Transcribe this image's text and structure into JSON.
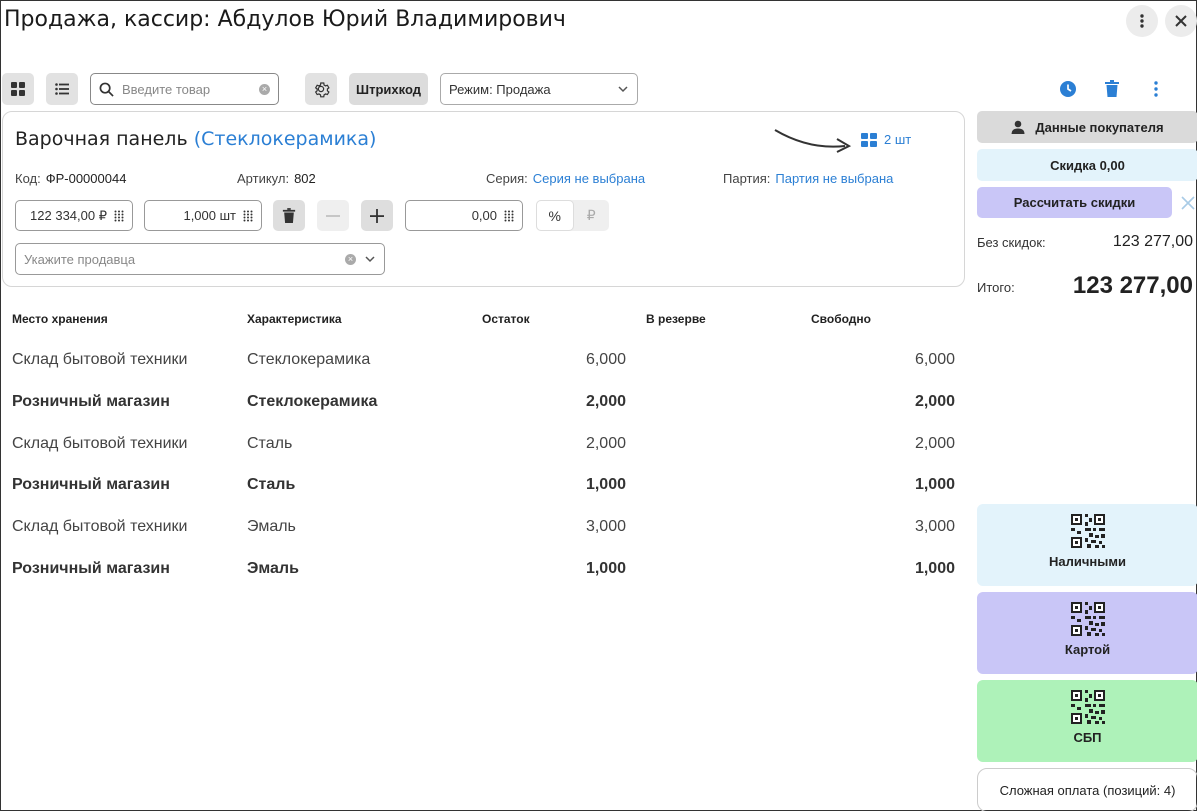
{
  "window": {
    "title": "Продажа, кассир: Абдулов Юрий Владимирович"
  },
  "toolbar": {
    "search_placeholder": "Введите товар",
    "barcode_label": "Штрихкод",
    "mode_label": "Режим: Продажа"
  },
  "product": {
    "name": "Варочная панель",
    "variant": "(Стеклокерамика)",
    "quantity_link": "2 шт",
    "code_label": "Код:",
    "code_value": "ФР-00000044",
    "article_label": "Артикул:",
    "article_value": "802",
    "series_label": "Серия:",
    "series_value": "Серия не выбрана",
    "batch_label": "Партия:",
    "batch_value": "Партия не выбрана",
    "price": "122 334,00 ₽",
    "quantity": "1,000 шт",
    "discount_value": "0,00",
    "discount_percent": "%",
    "discount_rub": "₽",
    "seller_placeholder": "Укажите продавца"
  },
  "stock_table": {
    "headers": [
      "Место хранения",
      "Характеристика",
      "Остаток",
      "В резерве",
      "Свободно"
    ],
    "rows": [
      {
        "place": "Склад бытовой техники",
        "variant": "Стеклокерамика",
        "stock": "6,000",
        "reserve": "",
        "free": "6,000",
        "bold": false
      },
      {
        "place": "Розничный магазин",
        "variant": "Стеклокерамика",
        "stock": "2,000",
        "reserve": "",
        "free": "2,000",
        "bold": true
      },
      {
        "place": "Склад бытовой техники",
        "variant": "Сталь",
        "stock": "2,000",
        "reserve": "",
        "free": "2,000",
        "bold": false
      },
      {
        "place": "Розничный магазин",
        "variant": "Сталь",
        "stock": "1,000",
        "reserve": "",
        "free": "1,000",
        "bold": true
      },
      {
        "place": "Склад бытовой техники",
        "variant": "Эмаль",
        "stock": "3,000",
        "reserve": "",
        "free": "3,000",
        "bold": false
      },
      {
        "place": "Розничный магазин",
        "variant": "Эмаль",
        "stock": "1,000",
        "reserve": "",
        "free": "1,000",
        "bold": true
      }
    ]
  },
  "sidebar": {
    "customer_label": "Данные покупателя",
    "discount_label": "Скидка 0,00",
    "calc_label": "Рассчитать скидки",
    "without_discount_label": "Без скидок:",
    "without_discount_value": "123 277,00",
    "total_label": "Итого:",
    "total_value": "123 277,00",
    "cash_label": "Наличными",
    "card_label": "Картой",
    "sbp_label": "СБП",
    "complex_label": "Сложная оплата (позиций: 4)"
  },
  "colors": {
    "accent_blue": "#2b7fd4",
    "discount_bg": "#e3f3fb",
    "calc_bg": "#c9c6f7",
    "cash_bg": "#e3f3fb",
    "card_bg": "#c9c6f7",
    "sbp_bg": "#aef2b9"
  }
}
